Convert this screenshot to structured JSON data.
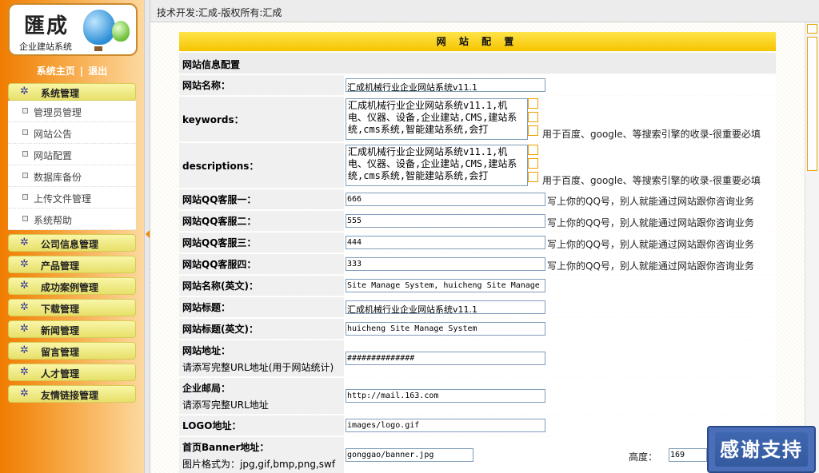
{
  "header": {
    "copyright": "技术开发:汇成-版权所有:汇成"
  },
  "logo": {
    "title": "匯成",
    "subtitle": "企业建站系统"
  },
  "topnav": {
    "home": "系统主页",
    "separator": "|",
    "logout": "退出"
  },
  "sidebar": {
    "system_group": "系统管理",
    "system_items": [
      "管理员管理",
      "网站公告",
      "网站配置",
      "数据库备份",
      "上传文件管理",
      "系统帮助"
    ],
    "groups": [
      "公司信息管理",
      "产品管理",
      "成功案例管理",
      "下载管理",
      "新闻管理",
      "留言管理",
      "人才管理",
      "友情链接管理"
    ]
  },
  "panel": {
    "title": "网 站 配 置",
    "section": "网站信息配置",
    "site_name": {
      "label": "网站名称：",
      "value": "汇成机械行业企业网站系统v11.1"
    },
    "keywords": {
      "label": "keywords：",
      "value": "汇成机械行业企业网站系统v11.1,机电、仪器、设备,企业建站,CMS,建站系统,cms系统,智能建站系统,会打",
      "hint": "用于百度、google、等搜索引擎的收录-很重要必填"
    },
    "descriptions": {
      "label": "descriptions：",
      "value": "汇成机械行业企业网站系统v11.1,机电、仪器、设备,企业建站,CMS,建站系统,cms系统,智能建站系统,会打",
      "hint": "用于百度、google、等搜索引擎的收录-很重要必填"
    },
    "qq1": {
      "label": "网站QQ客服一：",
      "value": "666",
      "hint": "写上你的QQ号，别人就能通过网站跟你咨询业务"
    },
    "qq2": {
      "label": "网站QQ客服二：",
      "value": "555",
      "hint": "写上你的QQ号，别人就能通过网站跟你咨询业务"
    },
    "qq3": {
      "label": "网站QQ客服三：",
      "value": "444",
      "hint": "写上你的QQ号，别人就能通过网站跟你咨询业务"
    },
    "qq4": {
      "label": "网站QQ客服四：",
      "value": "333",
      "hint": "写上你的QQ号，别人就能通过网站跟你咨询业务"
    },
    "site_name_en": {
      "label": "网站名称(英文)：",
      "value": "Site Manage System, huicheng Site Manage S"
    },
    "site_title": {
      "label": "网站标题：",
      "value": "汇成机械行业企业网站系统v11.1"
    },
    "site_title_en": {
      "label": "网站标题(英文)：",
      "value": "huicheng Site Manage System"
    },
    "site_url": {
      "label": "网站地址：",
      "note": "请添写完整URL地址(用于网站统计)",
      "value": "##############"
    },
    "email": {
      "label": "企业邮局：",
      "note": "请添写完整URL地址",
      "value": "http://mail.163.com"
    },
    "logo": {
      "label": "LOGO地址：",
      "value": "images/logo.gif"
    },
    "banner": {
      "label": "首页Banner地址：",
      "note": "图片格式为：jpg,gif,bmp,png,swf",
      "value": "gonggao/banner.jpg",
      "height_label": "高度：",
      "height_value": "169"
    }
  },
  "thanks": "感谢支持",
  "colors": {
    "accent": "#f5c400",
    "sidebar": "#f07c00",
    "thanks_bg": "#3f67b0"
  }
}
